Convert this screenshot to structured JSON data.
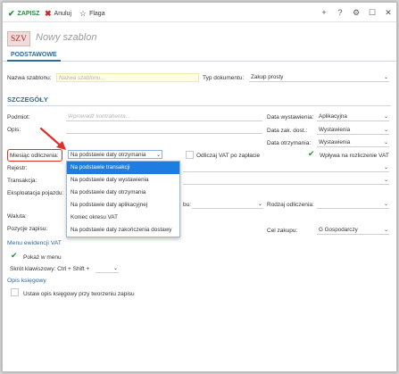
{
  "toolbar": {
    "save": "ZAPISZ",
    "cancel": "Anuluj",
    "flag": "Flaga"
  },
  "header": {
    "badge": "SZV",
    "title": "Nowy szablon"
  },
  "tabs": [
    "PODSTAWOWE"
  ],
  "form": {
    "template_name_label": "Nazwa szablonu:",
    "template_name_placeholder": "Nazwa szablonu...",
    "doc_type_label": "Typ dokumentu:",
    "doc_type_value": "Zakup prosty"
  },
  "details": {
    "section": "SZCZEGÓŁY",
    "subject_label": "Podmiot:",
    "subject_placeholder": "Wprowadź kontrahenta...",
    "description_label": "Opis:",
    "issue_date_label": "Data wystawienia:",
    "issue_date_value": "Aplikacyjna",
    "purchase_date_label": "Data zak. dost.:",
    "purchase_date_value": "Wystawienia",
    "received_date_label": "Data otrzymania:",
    "received_date_value": "Wystawienia",
    "month_label": "Miesiąc odliczenia:",
    "month_value": "Na podstawie daty otrzymania",
    "vat_payment_label": "Odliczaj VAT po zapłacie",
    "vat_settlement_label": "Wpływa na rozliczenie VAT",
    "register_label": "Rejestr:",
    "transaction_label": "Transakcja:",
    "exploitation_label": "Eksploatacja pojazdu:",
    "deduction_kind_label": "Rodzaj odliczenia:",
    "currency_label": "Waluta:",
    "position_label": "Pozycje zapisu:",
    "purchase_goal_label": "Cel zakupu:",
    "purchase_goal_value": "G Gospodarczy"
  },
  "dropdown_options": [
    "Na podstawie transakcji",
    "Na podstawie daty wystawienia",
    "Na podstawie daty otrzymania",
    "Na podstawie daty aplikacyjnej",
    "Koniec okresu VAT",
    "Na podstawie daty zakończenia dostawy"
  ],
  "menu": {
    "section": "Menu ewidencji VAT",
    "show_in_menu": "Pokaż w menu",
    "shortcut_label": "Skrót klawiszowy: Ctrl + Shift +",
    "ledger_section": "Opis księgowy",
    "ledger_option": "Ustaw opis księgowy przy tworzeniu zapisu"
  },
  "colors": {
    "accent": "#2c6aa0",
    "highlight": "#e0302a",
    "selected": "#1d7de0",
    "save": "#2a8a3a",
    "cancel": "#c8261f"
  }
}
